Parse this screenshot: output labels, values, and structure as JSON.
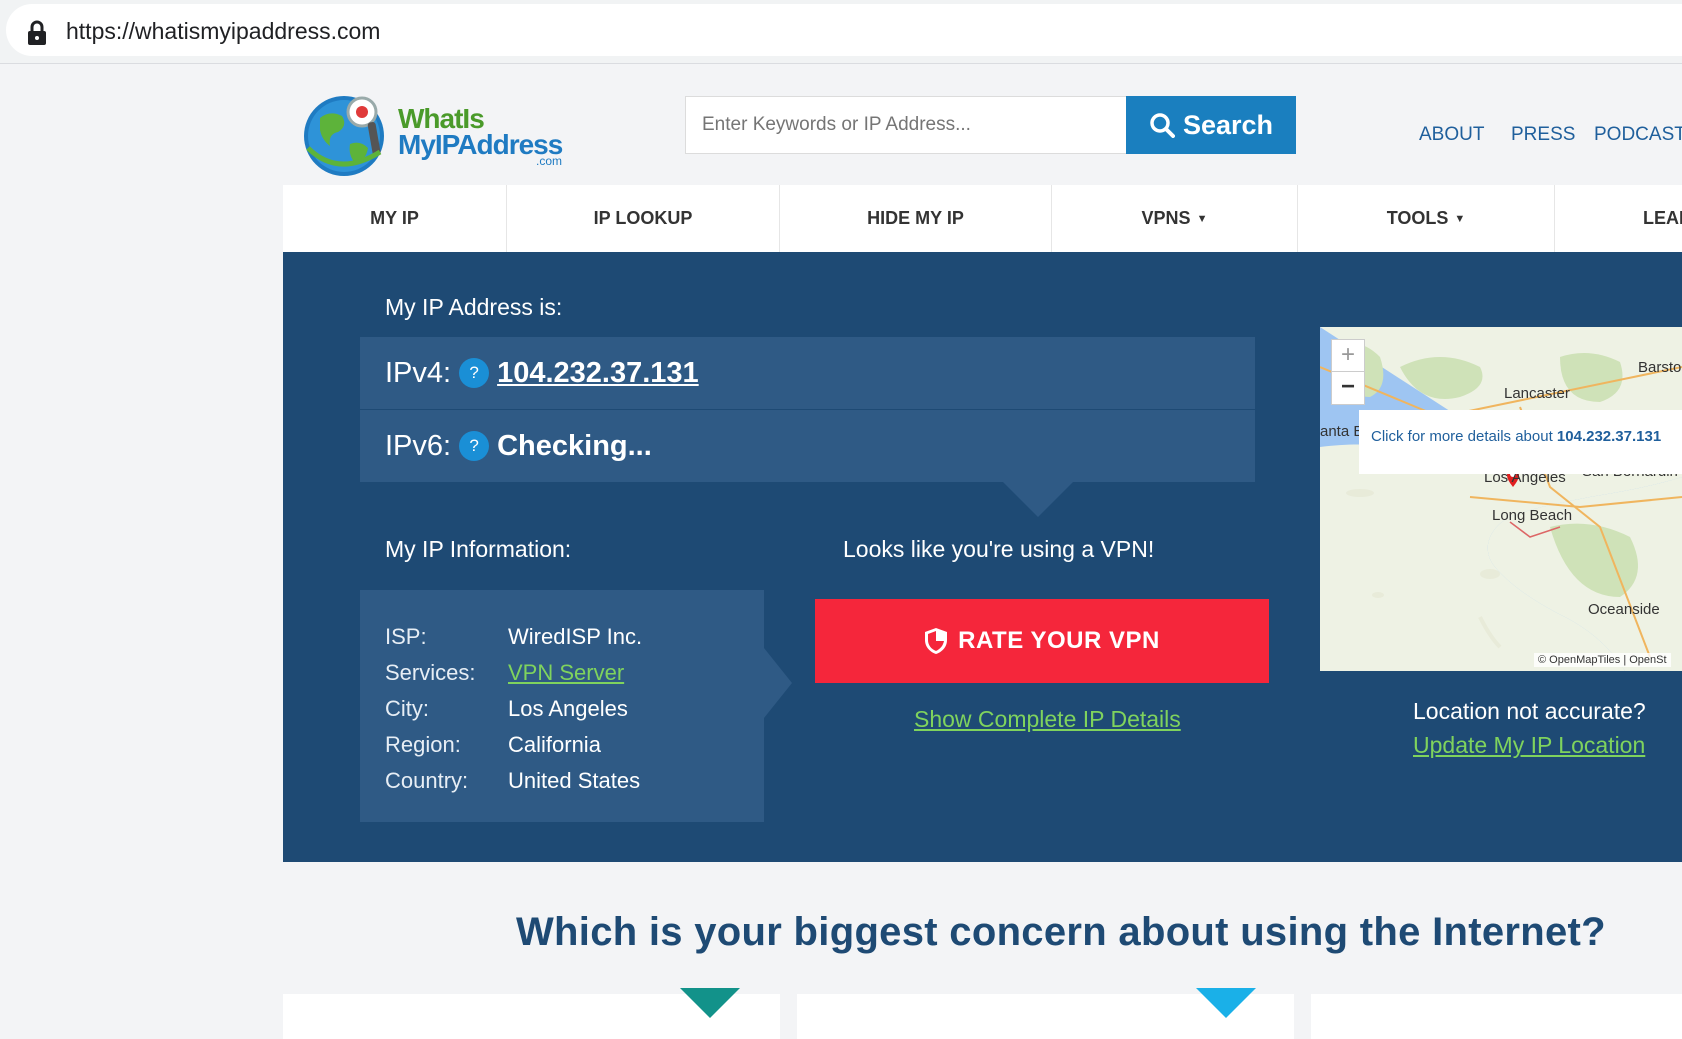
{
  "browser": {
    "url": "https://whatismyipaddress.com"
  },
  "header": {
    "logo_line1": "WhatIs",
    "logo_line2": "MyIPAddress",
    "logo_com": ".com",
    "search_placeholder": "Enter Keywords or IP Address...",
    "search_label": "Search",
    "links": [
      "ABOUT",
      "PRESS",
      "PODCAST"
    ]
  },
  "nav": {
    "items": [
      {
        "label": "MY IP"
      },
      {
        "label": "IP LOOKUP"
      },
      {
        "label": "HIDE MY IP"
      },
      {
        "label": "VPNS"
      },
      {
        "label": "TOOLS"
      },
      {
        "label": "LEAR"
      }
    ]
  },
  "hero": {
    "ip_heading": "My IP Address is:",
    "ipv4_label": "IPv4:",
    "ipv4_value": "104.232.37.131",
    "ipv6_label": "IPv6:",
    "ipv6_value": "Checking...",
    "qmark": "?",
    "info_heading": "My IP Information:",
    "info": [
      {
        "key": "ISP:",
        "value": "WiredISP Inc."
      },
      {
        "key": "Services:",
        "value": "VPN Server"
      },
      {
        "key": "City:",
        "value": "Los Angeles"
      },
      {
        "key": "Region:",
        "value": "California"
      },
      {
        "key": "Country:",
        "value": "United States"
      }
    ],
    "vpn_message": "Looks like you're using a VPN!",
    "rate_label": "RATE YOUR VPN",
    "details_link": "Show Complete IP Details",
    "map_tip_prefix": "Click for more details about ",
    "map_tip_ip": "104.232.37.131",
    "map_places": {
      "barstow": "Barsto",
      "lancaster": "Lancaster",
      "santa": "anta B",
      "los_angeles": "Los Angeles",
      "san_bernardino": "San Bernardin",
      "long_beach": "Long Beach",
      "oceanside": "Oceanside",
      "attribution": "© OpenMapTiles | OpenSt"
    },
    "location_question": "Location not accurate?",
    "location_link": "Update My IP Location"
  },
  "concern_heading": "Which is your biggest concern about using the Internet?",
  "colors": {
    "hero": "#1e4a74",
    "accent_red": "#f5263b",
    "link_green": "#7fd35d",
    "search_blue": "#1a7fbf"
  }
}
